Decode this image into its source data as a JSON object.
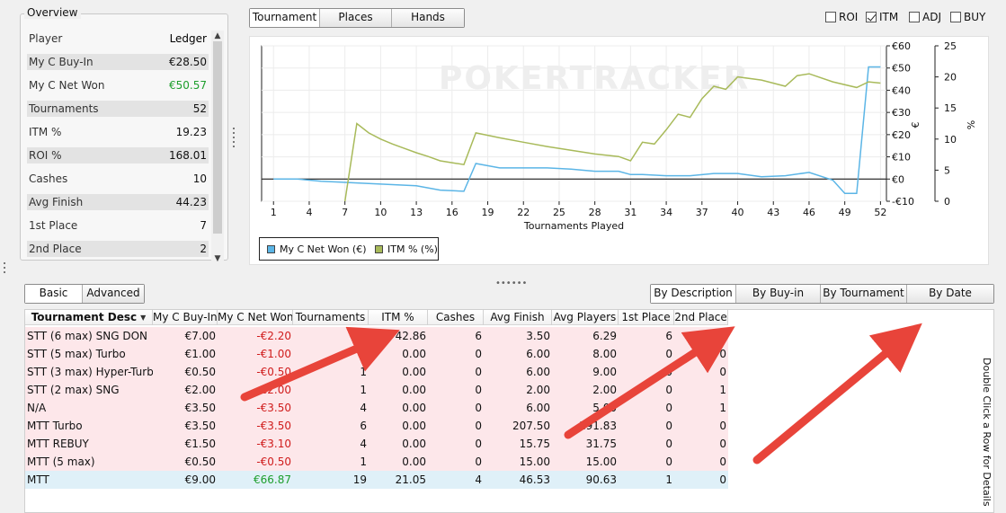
{
  "overview": {
    "title": "Overview",
    "header": {
      "label": "Player",
      "value": "Ledger"
    },
    "rows": [
      {
        "label": "My C Buy-In",
        "value": "€28.50"
      },
      {
        "label": "My C Net Won",
        "value": "€50.57"
      },
      {
        "label": "Tournaments",
        "value": "52"
      },
      {
        "label": "ITM %",
        "value": "19.23"
      },
      {
        "label": "ROI %",
        "value": "168.01"
      },
      {
        "label": "Cashes",
        "value": "10"
      },
      {
        "label": "Avg Finish",
        "value": "44.23"
      },
      {
        "label": "1st Place",
        "value": "7"
      },
      {
        "label": "2nd Place",
        "value": "2"
      }
    ],
    "scroll_up_icon": "chevron-up-icon",
    "scroll_down_icon": "chevron-down-icon"
  },
  "chart_tabs": [
    "Tournament",
    "Places",
    "Hands"
  ],
  "chart_checkboxes": [
    {
      "label": "ROI",
      "checked": false
    },
    {
      "label": "ITM",
      "checked": true
    },
    {
      "label": "ADJ",
      "checked": false
    },
    {
      "label": "BUY",
      "checked": false
    }
  ],
  "chart_data": {
    "type": "line",
    "watermark": "POKERTRACKER",
    "xlabel": "Tournaments Played",
    "x_ticks": [
      1,
      4,
      7,
      10,
      13,
      16,
      19,
      22,
      25,
      28,
      31,
      34,
      37,
      40,
      43,
      46,
      49,
      52
    ],
    "xlim": [
      0,
      52.5
    ],
    "y_left": {
      "unit": "€",
      "ticks": [
        "-€10",
        "€0",
        "€10",
        "€20",
        "€30",
        "€40",
        "€50",
        "€60"
      ],
      "range": [
        -10,
        60
      ]
    },
    "y_right": {
      "unit": "%",
      "ticks": [
        "0",
        "5",
        "10",
        "15",
        "20",
        "25"
      ],
      "range": [
        0,
        25
      ]
    },
    "grid": true,
    "legend": "bottom-left",
    "series": [
      {
        "name": "My C Net Won (€)",
        "axis": "left",
        "color": "#5bb5e6",
        "x": [
          1,
          3,
          5,
          7,
          9,
          11,
          13,
          15,
          17,
          18,
          20,
          22,
          24,
          26,
          28,
          30,
          31,
          32,
          34,
          36,
          38,
          40,
          42,
          44,
          46,
          48,
          49,
          50,
          51,
          52
        ],
        "y": [
          0,
          0,
          -1,
          -1.5,
          -2,
          -2.5,
          -3,
          -5,
          -5.5,
          7,
          5,
          5,
          5,
          4.5,
          3.5,
          3.5,
          2,
          2,
          1.5,
          1.5,
          2.5,
          2.5,
          1,
          1.5,
          3,
          -0.5,
          -6.5,
          -6.5,
          50.5,
          50.5
        ]
      },
      {
        "name": "ITM % (%)",
        "axis": "right",
        "color": "#a8ba5a",
        "x": [
          7,
          8,
          9,
          10,
          11,
          12,
          13,
          14,
          15,
          16,
          17,
          18,
          20,
          22,
          24,
          26,
          28,
          30,
          31,
          32,
          33,
          34,
          35,
          36,
          37,
          38,
          39,
          40,
          42,
          44,
          45,
          46,
          48,
          50,
          51,
          52
        ],
        "y": [
          0,
          12.5,
          11,
          10,
          9.2,
          8.5,
          7.8,
          7.2,
          6.5,
          6.2,
          5.9,
          11,
          10.2,
          9.5,
          8.8,
          8.2,
          7.6,
          7.2,
          6.5,
          9.5,
          9.2,
          11.5,
          14,
          13.5,
          16.5,
          18.5,
          18,
          20,
          19.5,
          18.5,
          20.2,
          20.5,
          19.2,
          18.3,
          19.2,
          19
        ]
      }
    ]
  },
  "table_mode_tabs": [
    "Basic",
    "Advanced"
  ],
  "table_view_tabs": [
    "By Description",
    "By Buy-in",
    "By Tournament",
    "By Date"
  ],
  "table": {
    "columns": [
      "Tournament Desc",
      "My C Buy-In",
      "My C Net Won",
      "Tournaments",
      "ITM %",
      "Cashes",
      "Avg Finish",
      "Avg Players",
      "1st Place",
      "2nd Place"
    ],
    "rows": [
      [
        "STT (6 max) SNG DON",
        "€7.00",
        "-€2.20",
        "14",
        "42.86",
        "6",
        "3.50",
        "6.29",
        "6",
        "0"
      ],
      [
        "STT (5 max) Turbo",
        "€1.00",
        "-€1.00",
        "2",
        "0.00",
        "0",
        "6.00",
        "8.00",
        "0",
        "0"
      ],
      [
        "STT (3 max) Hyper-Turbo",
        "€0.50",
        "-€0.50",
        "1",
        "0.00",
        "0",
        "6.00",
        "9.00",
        "0",
        "0"
      ],
      [
        "STT (2 max) SNG",
        "€2.00",
        "-€2.00",
        "1",
        "0.00",
        "0",
        "2.00",
        "2.00",
        "0",
        "1"
      ],
      [
        "N/A",
        "€3.50",
        "-€3.50",
        "4",
        "0.00",
        "0",
        "6.00",
        "5.00",
        "0",
        "1"
      ],
      [
        "MTT Turbo",
        "€3.50",
        "-€3.50",
        "6",
        "0.00",
        "0",
        "207.50",
        "191.83",
        "0",
        "0"
      ],
      [
        "MTT REBUY",
        "€1.50",
        "-€3.10",
        "4",
        "0.00",
        "0",
        "15.75",
        "31.75",
        "0",
        "0"
      ],
      [
        "MTT (5 max)",
        "€0.50",
        "-€0.50",
        "1",
        "0.00",
        "0",
        "15.00",
        "15.00",
        "0",
        "0"
      ],
      [
        "MTT",
        "€9.00",
        "€66.87",
        "19",
        "21.05",
        "4",
        "46.53",
        "90.63",
        "1",
        "0"
      ]
    ],
    "summary_row_index": 8
  },
  "side_note": "Double Click a Row for Details",
  "colors": {
    "net_won_series": "#5bb5e6",
    "itm_series": "#a8ba5a",
    "negative": "#d01c1c",
    "positive": "#1d9e2c",
    "row_pink": "#fde7ea",
    "row_blue": "#dff0f8",
    "arrow": "#e8443a"
  }
}
